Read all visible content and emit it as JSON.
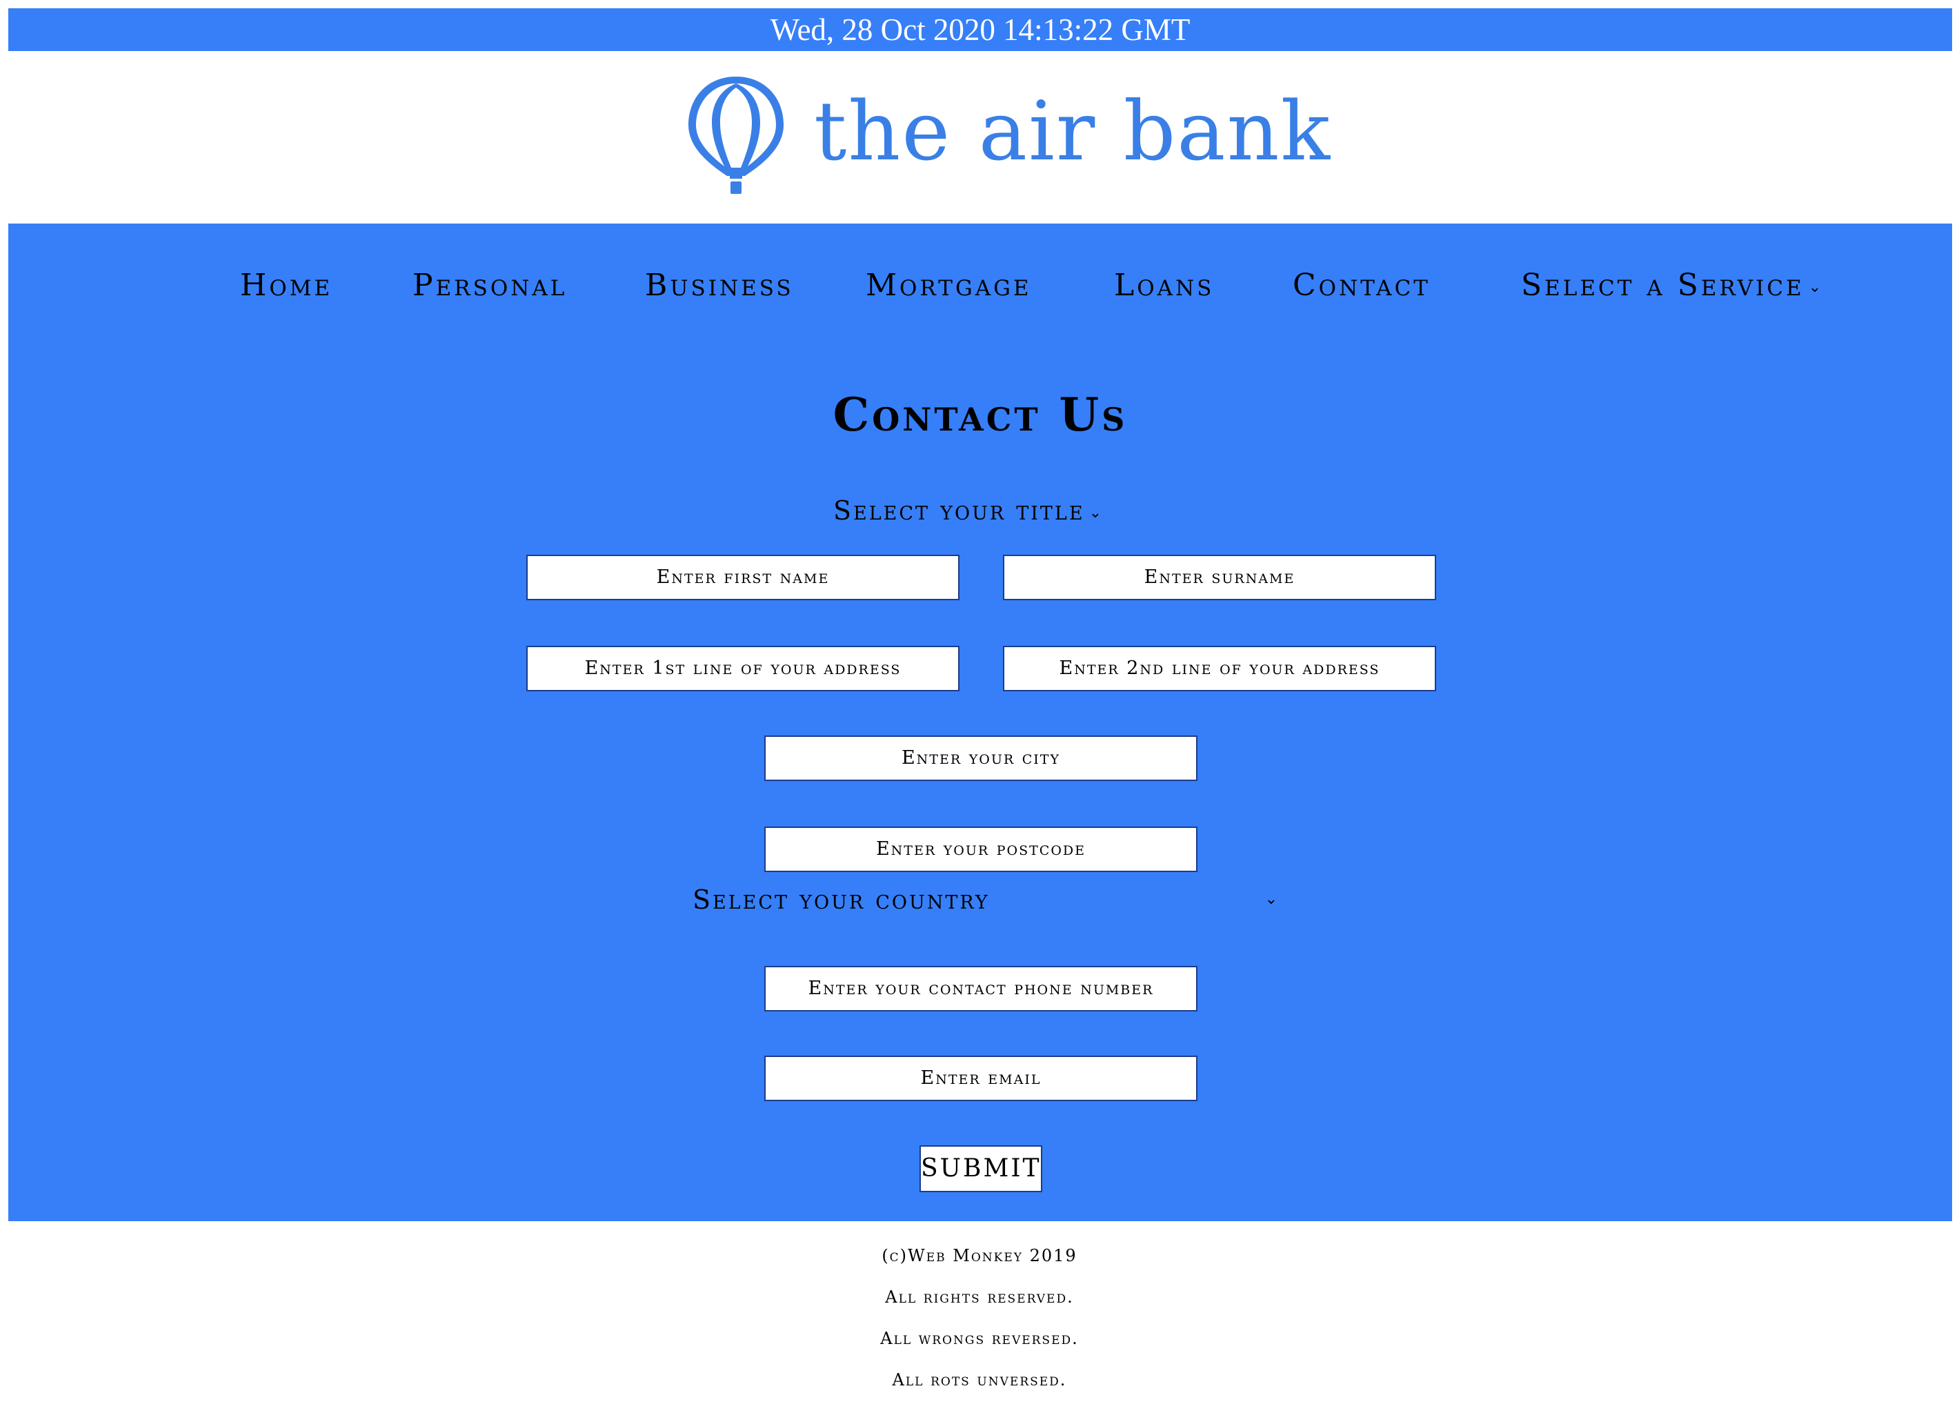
{
  "datebar": {
    "text": "Wed, 28 Oct 2020 14:13:22 GMT"
  },
  "logo": {
    "text": "the air bank",
    "icon": "hot-air-balloon-icon"
  },
  "colors": {
    "primary": "#367ff8",
    "logo": "#3a7fe6",
    "field_border": "#1b3b8c"
  },
  "nav": {
    "items": [
      "Home",
      "Personal",
      "Business",
      "Mortgage",
      "Loans",
      "Contact"
    ],
    "service_select": "Select a Service"
  },
  "form": {
    "heading": "Contact Us",
    "title_select": "Select your title",
    "first_name_placeholder": "Enter first name",
    "surname_placeholder": "Enter surname",
    "address1_placeholder": "Enter 1st line of your address",
    "address2_placeholder": "Enter 2nd line of your address",
    "city_placeholder": "Enter your city",
    "postcode_placeholder": "Enter your postcode",
    "country_select": "Select your country",
    "phone_placeholder": "Enter your contact phone number",
    "email_placeholder": "Enter email",
    "submit_label": "SUBMIT"
  },
  "footer": {
    "lines": [
      "(c)Web Monkey 2019",
      "All rights reserved.",
      "All wrongs reversed.",
      "All rots unversed."
    ]
  }
}
